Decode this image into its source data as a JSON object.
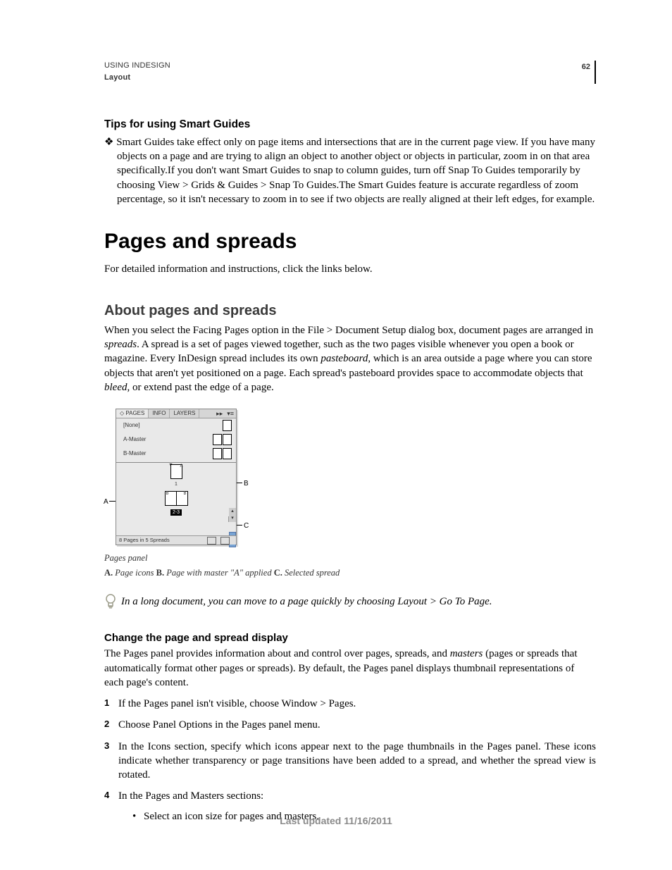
{
  "header": {
    "running_title": "USING INDESIGN",
    "section": "Layout",
    "page_number": "62"
  },
  "tips": {
    "heading": "Tips for using Smart Guides",
    "bullet": "Smart Guides take effect only on page items and intersections that are in the current page view. If you have many objects on a page and are trying to align an object to another object or objects in particular, zoom in on that area specifically.If you don't want Smart Guides to snap to column guides, turn off Snap To Guides temporarily by choosing View > Grids & Guides > Snap To Guides.The Smart Guides feature is accurate regardless of zoom percentage, so it isn't necessary to zoom in to see if two objects are really aligned at their left edges, for example."
  },
  "h1": "Pages and spreads",
  "intro": "For detailed information and instructions, click the links below.",
  "about": {
    "heading": "About pages and spreads",
    "p1a": "When you select the Facing Pages option in the File > Document Setup dialog box, document pages are arranged in ",
    "p1b_italic": "spreads",
    "p1c": ". A spread is a set of pages viewed together, such as the two pages visible whenever you open a book or magazine. Every InDesign spread includes its own ",
    "p1d_italic": "pasteboard",
    "p1e": ", which is an area outside a page where you can store objects that aren't yet positioned on a page. Each spread's pasteboard provides space to accommodate objects that ",
    "p1f_italic": "bleed",
    "p1g": ", or extend past the edge of a page."
  },
  "panel": {
    "tabs": {
      "pages": "◇ PAGES",
      "info": "INFO",
      "layers": "LAYERS"
    },
    "masters": {
      "none": "[None]",
      "a": "A-Master",
      "b": "B-Master"
    },
    "page1_label": "1",
    "spread1_left": "B",
    "spread1_right": "B",
    "spread1_label": "2-3",
    "page_right_a": "A",
    "footer": "8 Pages in 5 Spreads"
  },
  "callouts": {
    "A": "A",
    "B": "B",
    "C": "C"
  },
  "figcap": {
    "title": "Pages panel",
    "A": "A.",
    "A_text": " Page icons  ",
    "B": "B.",
    "B_text": " Page with master \"A\" applied  ",
    "C": "C.",
    "C_text": " Selected spread"
  },
  "tip": "In a long document, you can move to a page quickly by choosing Layout > Go To Page.",
  "change": {
    "heading": "Change the page and spread display",
    "p_a": "The Pages panel provides information about and control over pages, spreads, and ",
    "p_b_italic": "masters",
    "p_c": " (pages or spreads that automatically format other pages or spreads). By default, the Pages panel displays thumbnail representations of each page's content.",
    "steps": [
      "If the Pages panel isn't visible, choose Window > Pages.",
      "Choose Panel Options in the Pages panel menu.",
      "In the Icons section, specify which icons appear next to the page thumbnails in the Pages panel. These icons indicate whether transparency or page transitions have been added to a spread, and whether the spread view is rotated.",
      "In the Pages and Masters sections:"
    ],
    "sub1": "Select an icon size for pages and masters."
  },
  "footer": "Last updated 11/16/2011"
}
